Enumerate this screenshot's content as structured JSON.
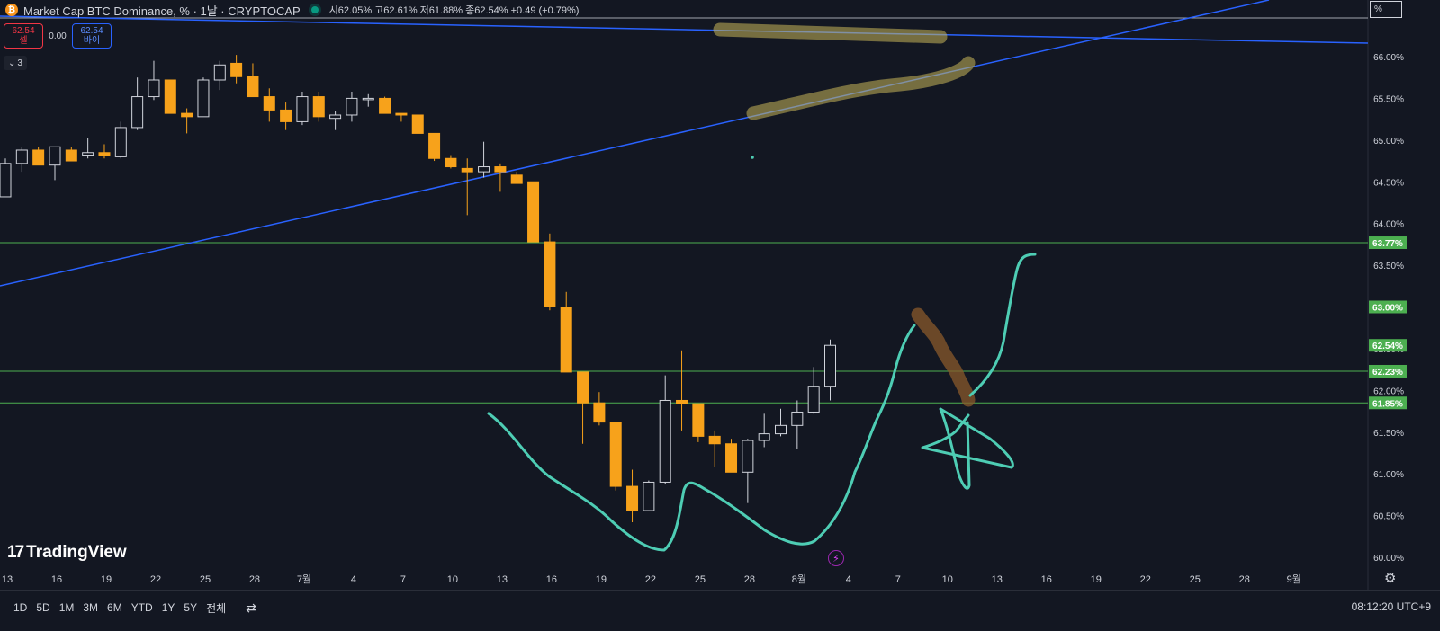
{
  "header": {
    "btc_icon": "bitcoin-icon",
    "title": "Market Cap BTC Dominance, % · 1날 · CRYPTOCAP",
    "ohlc": "시62.05% 고62.61% 저61.88% 종62.54% +0.49 (+0.79%)"
  },
  "trade": {
    "sell_price": "62.54",
    "sell_label": "셀",
    "spread": "0.00",
    "buy_price": "62.54",
    "buy_label": "바이"
  },
  "indicators_count": "3",
  "scale_mode": "%",
  "branding": "TradingView",
  "bottom": {
    "ranges": [
      "1D",
      "5D",
      "1M",
      "3M",
      "6M",
      "YTD",
      "1Y",
      "5Y",
      "전체"
    ],
    "clock": "08:12:20 UTC+9"
  },
  "colors": {
    "background": "#131722",
    "up_body": "#131722",
    "up_border": "#d1d4dc",
    "down_body": "#f7a21b",
    "hline": "#4caf50",
    "trendline": "#2962ff",
    "drawing": "#4ecdb4",
    "highlight_yellow": "#c8b65a",
    "highlight_brown": "#8a5a2b"
  },
  "chart_data": {
    "type": "candlestick",
    "title": "Market Cap BTC Dominance, %",
    "ylim": [
      59.95,
      66.4
    ],
    "y_ticks": [
      "60.00%",
      "60.50%",
      "61.00%",
      "61.50%",
      "62.00%",
      "62.50%",
      "63.00%",
      "63.50%",
      "64.00%",
      "64.50%",
      "65.00%",
      "65.50%",
      "66.00%"
    ],
    "x_tick_labels": [
      "13",
      "16",
      "19",
      "22",
      "25",
      "28",
      "7월",
      "4",
      "7",
      "10",
      "13",
      "16",
      "19",
      "22",
      "25",
      "28",
      "8월",
      "4",
      "7",
      "10",
      "13",
      "16",
      "19",
      "22",
      "25",
      "28",
      "9월"
    ],
    "horizontal_levels": [
      "63.77%",
      "63.00%",
      "62.23%",
      "61.85%"
    ],
    "last_price_label": "62.54%",
    "candles": [
      {
        "o": 64.32,
        "h": 64.78,
        "l": 64.32,
        "c": 64.72
      },
      {
        "o": 64.72,
        "h": 64.92,
        "l": 64.62,
        "c": 64.88
      },
      {
        "o": 64.88,
        "h": 64.92,
        "l": 64.7,
        "c": 64.7
      },
      {
        "o": 64.7,
        "h": 64.92,
        "l": 64.52,
        "c": 64.92
      },
      {
        "o": 64.88,
        "h": 64.92,
        "l": 64.75,
        "c": 64.75
      },
      {
        "o": 64.82,
        "h": 65.02,
        "l": 64.78,
        "c": 64.85
      },
      {
        "o": 64.85,
        "h": 64.95,
        "l": 64.78,
        "c": 64.82
      },
      {
        "o": 64.8,
        "h": 65.22,
        "l": 64.78,
        "c": 65.15
      },
      {
        "o": 65.15,
        "h": 65.75,
        "l": 65.12,
        "c": 65.52
      },
      {
        "o": 65.52,
        "h": 65.95,
        "l": 65.48,
        "c": 65.72
      },
      {
        "o": 65.72,
        "h": 65.72,
        "l": 65.32,
        "c": 65.32
      },
      {
        "o": 65.32,
        "h": 65.38,
        "l": 65.08,
        "c": 65.28
      },
      {
        "o": 65.28,
        "h": 65.75,
        "l": 65.28,
        "c": 65.72
      },
      {
        "o": 65.72,
        "h": 65.95,
        "l": 65.6,
        "c": 65.9
      },
      {
        "o": 65.92,
        "h": 66.02,
        "l": 65.68,
        "c": 65.76
      },
      {
        "o": 65.76,
        "h": 65.92,
        "l": 65.52,
        "c": 65.52
      },
      {
        "o": 65.52,
        "h": 65.62,
        "l": 65.22,
        "c": 65.36
      },
      {
        "o": 65.36,
        "h": 65.45,
        "l": 65.12,
        "c": 65.22
      },
      {
        "o": 65.22,
        "h": 65.58,
        "l": 65.18,
        "c": 65.52
      },
      {
        "o": 65.52,
        "h": 65.58,
        "l": 65.22,
        "c": 65.28
      },
      {
        "o": 65.26,
        "h": 65.35,
        "l": 65.12,
        "c": 65.3
      },
      {
        "o": 65.3,
        "h": 65.58,
        "l": 65.22,
        "c": 65.5
      },
      {
        "o": 65.5,
        "h": 65.55,
        "l": 65.4,
        "c": 65.5
      },
      {
        "o": 65.5,
        "h": 65.52,
        "l": 65.32,
        "c": 65.32
      },
      {
        "o": 65.32,
        "h": 65.32,
        "l": 65.22,
        "c": 65.3
      },
      {
        "o": 65.3,
        "h": 65.3,
        "l": 65.08,
        "c": 65.08
      },
      {
        "o": 65.08,
        "h": 65.08,
        "l": 64.75,
        "c": 64.78
      },
      {
        "o": 64.78,
        "h": 64.82,
        "l": 64.66,
        "c": 64.68
      },
      {
        "o": 64.66,
        "h": 64.78,
        "l": 64.1,
        "c": 64.62
      },
      {
        "o": 64.62,
        "h": 64.98,
        "l": 64.55,
        "c": 64.68
      },
      {
        "o": 64.68,
        "h": 64.72,
        "l": 64.38,
        "c": 64.62
      },
      {
        "o": 64.58,
        "h": 64.62,
        "l": 64.48,
        "c": 64.48
      },
      {
        "o": 64.5,
        "h": 64.5,
        "l": 63.78,
        "c": 63.78
      },
      {
        "o": 63.78,
        "h": 63.88,
        "l": 62.96,
        "c": 63.0
      },
      {
        "o": 63.0,
        "h": 63.18,
        "l": 62.22,
        "c": 62.22
      },
      {
        "o": 62.22,
        "h": 62.22,
        "l": 61.36,
        "c": 61.85
      },
      {
        "o": 61.85,
        "h": 61.98,
        "l": 61.58,
        "c": 61.62
      },
      {
        "o": 61.62,
        "h": 61.62,
        "l": 60.8,
        "c": 60.85
      },
      {
        "o": 60.85,
        "h": 61.05,
        "l": 60.42,
        "c": 60.56
      },
      {
        "o": 60.56,
        "h": 60.92,
        "l": 60.56,
        "c": 60.9
      },
      {
        "o": 60.9,
        "h": 62.18,
        "l": 60.88,
        "c": 61.88
      },
      {
        "o": 61.88,
        "h": 62.48,
        "l": 61.52,
        "c": 61.84
      },
      {
        "o": 61.84,
        "h": 61.84,
        "l": 61.38,
        "c": 61.45
      },
      {
        "o": 61.45,
        "h": 61.52,
        "l": 61.08,
        "c": 61.36
      },
      {
        "o": 61.36,
        "h": 61.42,
        "l": 61.02,
        "c": 61.02
      },
      {
        "o": 61.02,
        "h": 61.42,
        "l": 60.65,
        "c": 61.4
      },
      {
        "o": 61.4,
        "h": 61.72,
        "l": 61.32,
        "c": 61.48
      },
      {
        "o": 61.48,
        "h": 61.78,
        "l": 61.45,
        "c": 61.58
      },
      {
        "o": 61.58,
        "h": 61.88,
        "l": 61.3,
        "c": 61.74
      },
      {
        "o": 61.74,
        "h": 62.28,
        "l": 61.72,
        "c": 62.05
      },
      {
        "o": 62.05,
        "h": 62.61,
        "l": 61.88,
        "c": 62.54
      }
    ]
  }
}
